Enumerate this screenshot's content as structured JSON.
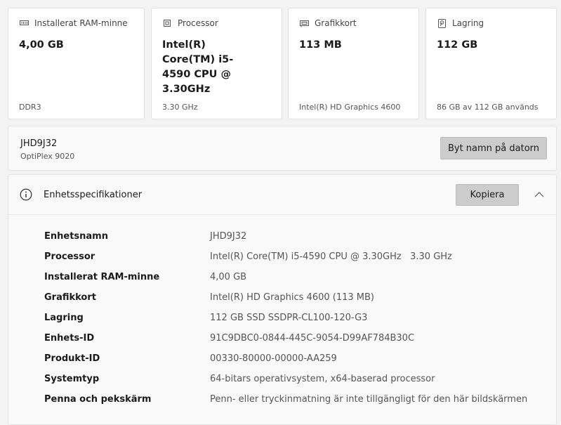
{
  "cards": [
    {
      "label": "Installerat RAM-minne",
      "value": "4,00 GB",
      "sub": "DDR3",
      "icon": "ram-icon"
    },
    {
      "label": "Processor",
      "value": "Intel(R) Core(TM) i5-4590 CPU @ 3.30GHz",
      "sub": "3.30 GHz",
      "icon": "processor-icon"
    },
    {
      "label": "Grafikkort",
      "value": "113 MB",
      "sub": "Intel(R) HD Graphics 4600",
      "icon": "graphics-card-icon"
    },
    {
      "label": "Lagring",
      "value": "112 GB",
      "sub": "86 GB av 112 GB används",
      "icon": "storage-icon"
    }
  ],
  "device": {
    "name": "JHD9J32",
    "model": "OptiPlex 9020",
    "rename_label": "Byt namn på datorn"
  },
  "specs": {
    "title": "Enhetsspecifikationer",
    "copy_label": "Kopiera",
    "rows": [
      {
        "label": "Enhetsnamn",
        "value": "JHD9J32"
      },
      {
        "label": "Processor",
        "value": "Intel(R) Core(TM) i5-4590 CPU @ 3.30GHz   3.30 GHz"
      },
      {
        "label": "Installerat RAM-minne",
        "value": "4,00 GB"
      },
      {
        "label": "Grafikkort",
        "value": "Intel(R) HD Graphics 4600 (113 MB)"
      },
      {
        "label": "Lagring",
        "value": "112 GB SSD SSDPR-CL100-120-G3"
      },
      {
        "label": "Enhets-ID",
        "value": "91C9DBC0-0844-445C-9054-D99AF784B30C"
      },
      {
        "label": "Produkt-ID",
        "value": "00330-80000-00000-AA259"
      },
      {
        "label": "Systemtyp",
        "value": "64-bitars operativsystem, x64-baserad processor"
      },
      {
        "label": "Penna och pekskärm",
        "value": "Penn- eller tryckinmatning är inte tillgängligt för den här bildskärmen"
      }
    ]
  },
  "colors": {
    "background": "#f3f3f3",
    "card": "#ffffff",
    "button": "#cccccc"
  }
}
